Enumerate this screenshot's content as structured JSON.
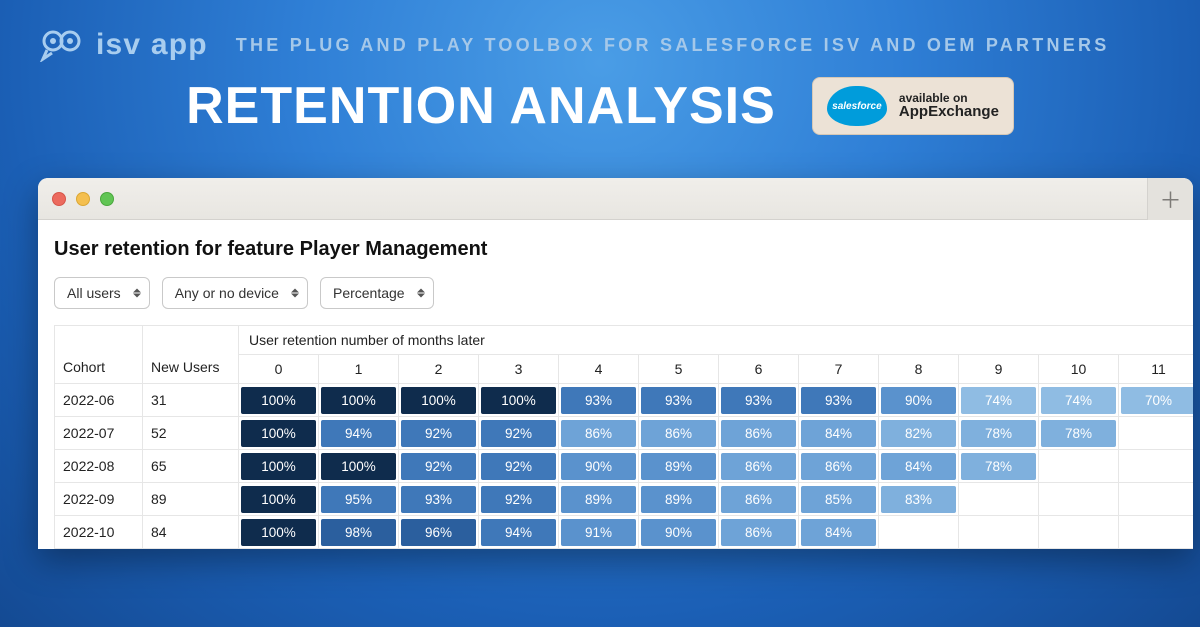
{
  "brand": {
    "name": "ISV app",
    "tagline": "THE PLUG AND PLAY TOOLBOX FOR SALESFORCE ISV AND OEM PARTNERS"
  },
  "hero": {
    "title": "RETENTION ANALYSIS"
  },
  "appexchange": {
    "cloud_text": "salesforce",
    "line1": "available on",
    "line2": "AppExchange"
  },
  "plus_glyph": "＋",
  "panel": {
    "title": "User retention for feature Player Management",
    "filters": {
      "users": "All users",
      "device": "Any or no device",
      "mode": "Percentage"
    },
    "table": {
      "cohort_header": "Cohort",
      "new_users_header": "New Users",
      "months_group_header": "User retention number of months later",
      "months": [
        "0",
        "1",
        "2",
        "3",
        "4",
        "5",
        "6",
        "7",
        "8",
        "9",
        "10",
        "11"
      ]
    }
  },
  "chart_data": {
    "type": "heatmap",
    "title": "User retention for feature Player Management",
    "xlabel": "User retention number of months later",
    "ylabel": "Cohort",
    "x": [
      0,
      1,
      2,
      3,
      4,
      5,
      6,
      7,
      8,
      9,
      10,
      11
    ],
    "cohorts": [
      {
        "cohort": "2022-06",
        "new_users": 31,
        "values": [
          100,
          100,
          100,
          100,
          93,
          93,
          93,
          93,
          90,
          74,
          74,
          70
        ]
      },
      {
        "cohort": "2022-07",
        "new_users": 52,
        "values": [
          100,
          94,
          92,
          92,
          86,
          86,
          86,
          84,
          82,
          78,
          78
        ]
      },
      {
        "cohort": "2022-08",
        "new_users": 65,
        "values": [
          100,
          100,
          92,
          92,
          90,
          89,
          86,
          86,
          84,
          78
        ]
      },
      {
        "cohort": "2022-09",
        "new_users": 89,
        "values": [
          100,
          95,
          93,
          92,
          89,
          89,
          86,
          85,
          83
        ]
      },
      {
        "cohort": "2022-10",
        "new_users": 84,
        "values": [
          100,
          98,
          96,
          94,
          91,
          90,
          86,
          84
        ]
      }
    ],
    "unit": "percent"
  }
}
